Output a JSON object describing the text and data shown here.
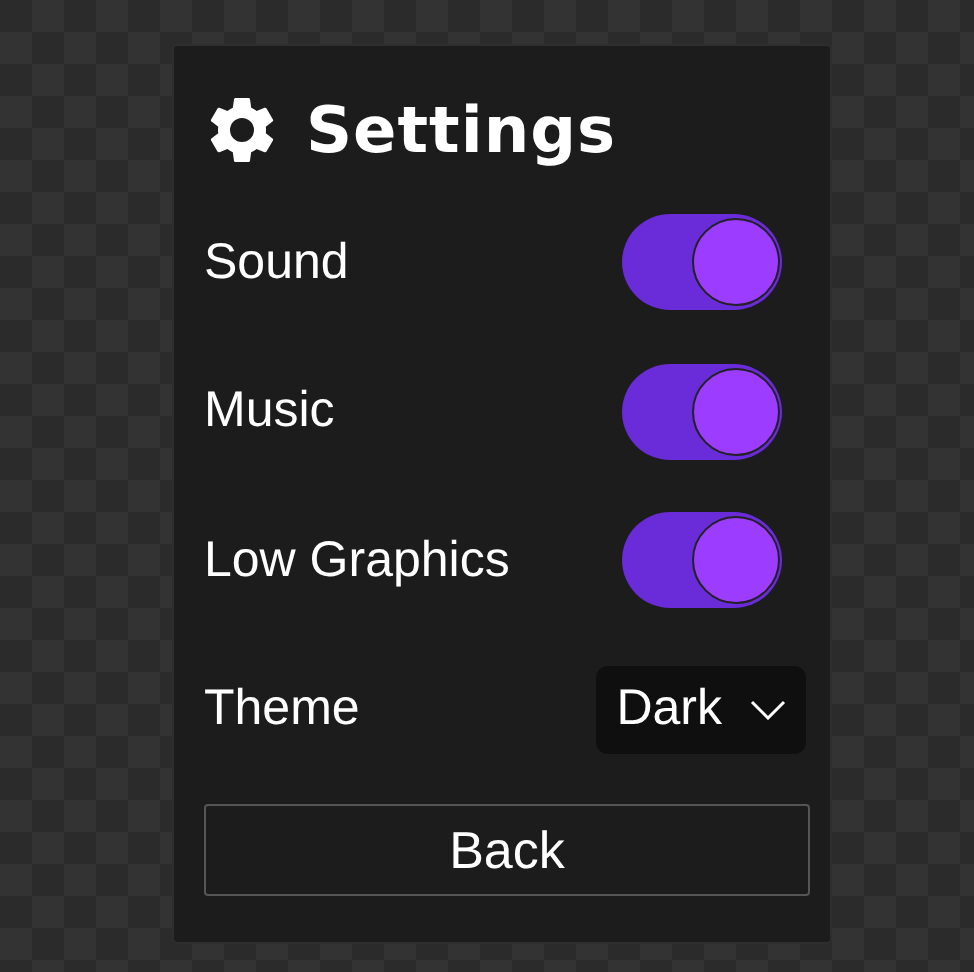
{
  "title": "Settings",
  "settings": [
    {
      "kind": "toggle",
      "label": "Sound",
      "on": true
    },
    {
      "kind": "toggle",
      "label": "Music",
      "on": true
    },
    {
      "kind": "toggle",
      "label": "Low Graphics",
      "on": true
    },
    {
      "kind": "dropdown",
      "label": "Theme",
      "value": "Dark"
    }
  ],
  "buttons": [
    "Back"
  ]
}
